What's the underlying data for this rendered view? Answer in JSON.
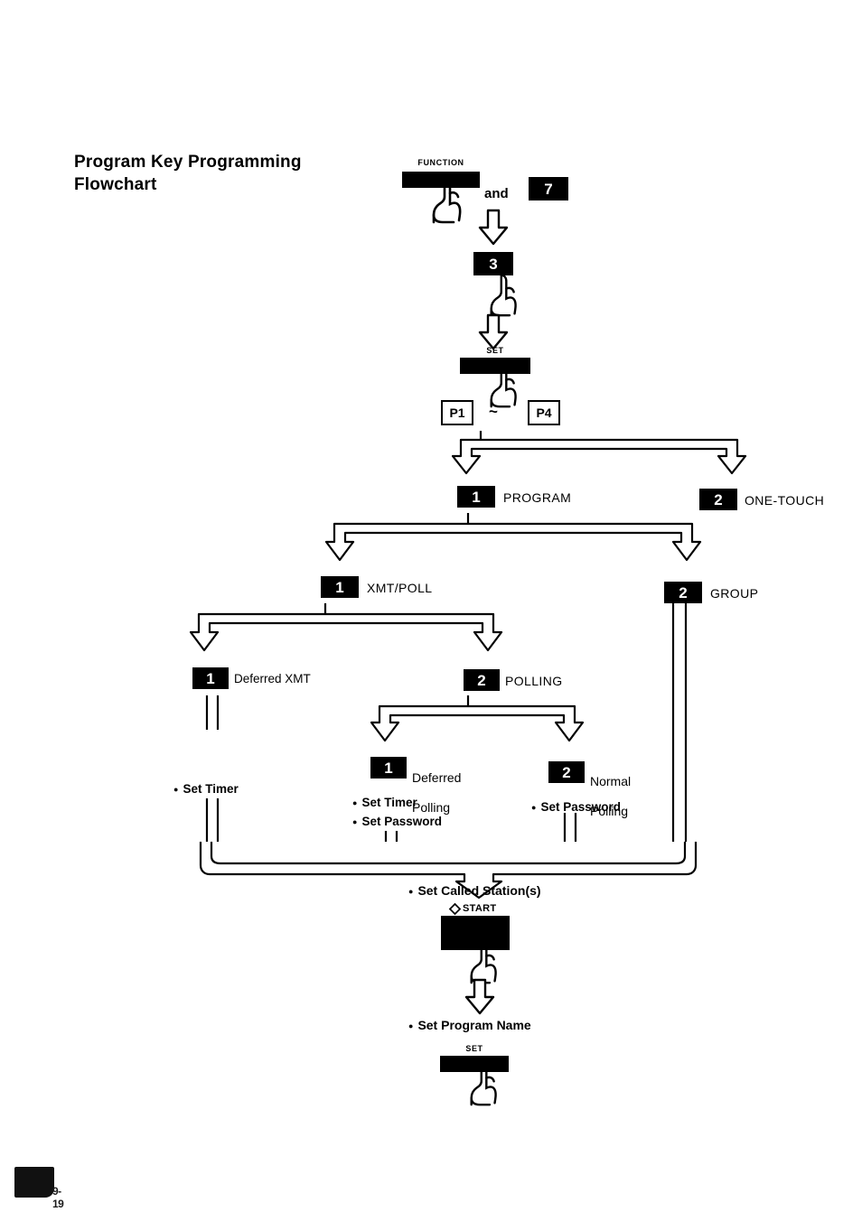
{
  "document": {
    "title_line1": "Program Key Programming",
    "title_line2": "Flowchart",
    "page_number": "9-19"
  },
  "flow": {
    "step_function": {
      "key_label": "FUNCTION",
      "conjunction": "and",
      "second_key": "7"
    },
    "step_three": {
      "key": "3"
    },
    "step_set": {
      "key_label": "SET"
    },
    "program_range": {
      "from": "P1",
      "separator": "~",
      "to": "P4"
    },
    "branch_program_type": [
      {
        "key": "1",
        "label": "PROGRAM"
      },
      {
        "key": "2",
        "label": "ONE-TOUCH"
      }
    ],
    "branch_program_mode": [
      {
        "key": "1",
        "label": "XMT/POLL"
      },
      {
        "key": "2",
        "label": "GROUP"
      }
    ],
    "branch_xmt_poll": [
      {
        "key": "1",
        "label": "Deferred XMT"
      },
      {
        "key": "2",
        "label": "POLLING"
      }
    ],
    "branch_polling": [
      {
        "key": "1",
        "label_line1": "Deferred",
        "label_line2": "Polling"
      },
      {
        "key": "2",
        "label_line1": "Normal",
        "label_line2": "Polling"
      }
    ],
    "options_deferred_xmt": [
      "Set Timer"
    ],
    "options_deferred_polling": [
      "Set Timer",
      "Set Password"
    ],
    "options_normal_polling": [
      "Set Password"
    ],
    "step_called_station": {
      "option": "Set Called Station(s)"
    },
    "step_start": {
      "key_label": "START",
      "glyph": "start-diamond-icon"
    },
    "step_program_name": {
      "option": "Set Program Name"
    },
    "step_final_set": {
      "key_label": "SET"
    }
  },
  "colors": {
    "ink": "#000000",
    "paper": "#ffffff"
  }
}
